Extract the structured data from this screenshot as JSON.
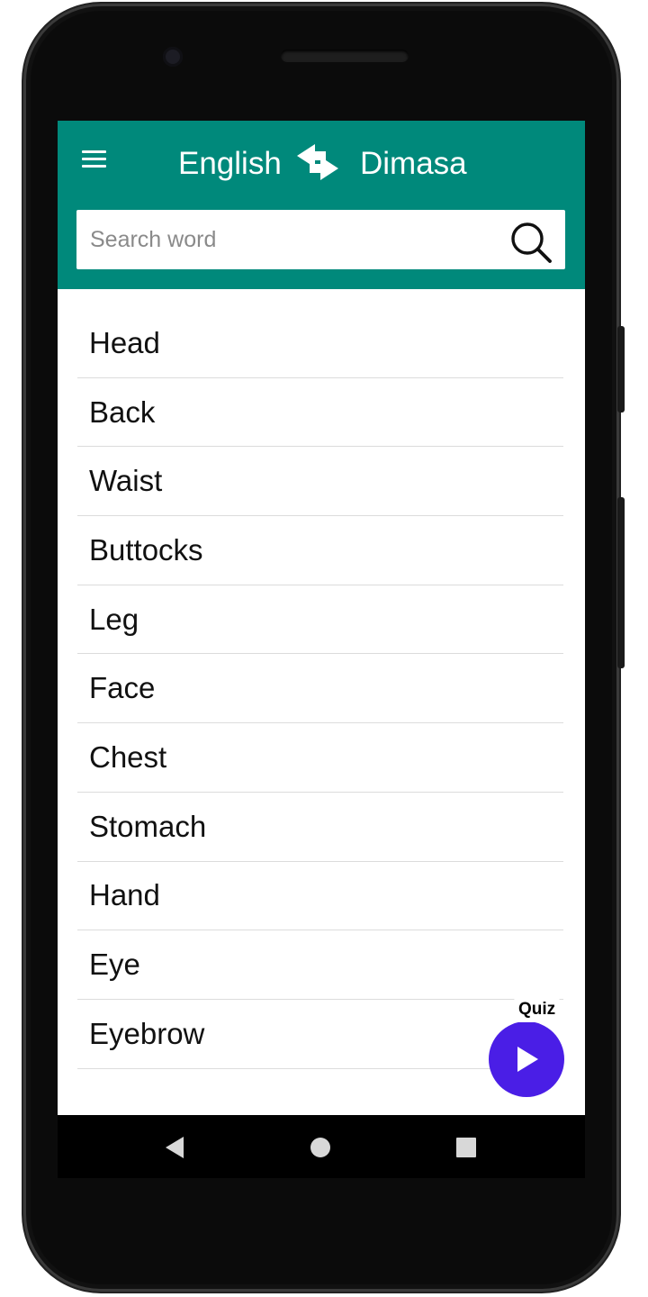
{
  "header": {
    "source_language": "English",
    "target_language": "Dimasa",
    "menu_icon": "hamburger-menu-icon",
    "swap_icon": "swap-arrows-icon"
  },
  "search": {
    "placeholder": "Search word",
    "value": "",
    "icon": "search-icon"
  },
  "words": [
    {
      "label": "Head"
    },
    {
      "label": "Back"
    },
    {
      "label": "Waist"
    },
    {
      "label": "Buttocks"
    },
    {
      "label": "Leg"
    },
    {
      "label": "Face"
    },
    {
      "label": "Chest"
    },
    {
      "label": "Stomach"
    },
    {
      "label": "Hand"
    },
    {
      "label": "Eye"
    },
    {
      "label": "Eyebrow"
    },
    {
      "label": ""
    }
  ],
  "quiz": {
    "label": "Quiz",
    "icon": "play-icon",
    "color": "#4a1ee6"
  },
  "theme": {
    "primary": "#00897b"
  },
  "navbar": {
    "icons": [
      "back-icon",
      "home-icon",
      "recents-icon"
    ]
  }
}
